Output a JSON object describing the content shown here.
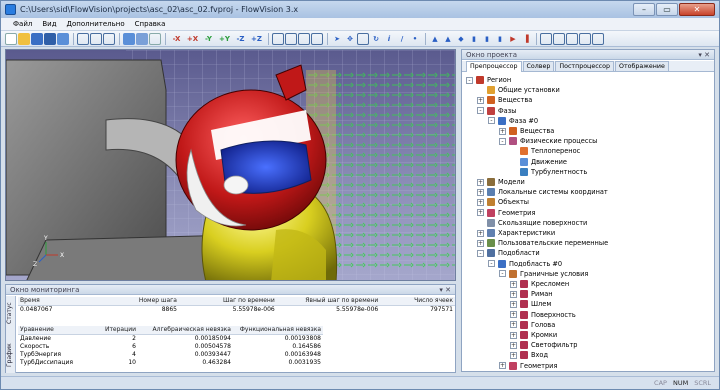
{
  "window": {
    "title": "C:\\Users\\sid\\FlowVision\\projects\\asc_02\\asc_02.fvproj - FlowVision 3.x"
  },
  "menu": [
    "Файл",
    "Вид",
    "Дополнительно",
    "Справка"
  ],
  "toolbar": {
    "axes": [
      "-X",
      "+X",
      "-Y",
      "+Y",
      "-Z",
      "+Z"
    ]
  },
  "viewport": {
    "axis_labels": [
      "Y",
      "X",
      "Z"
    ]
  },
  "monitor": {
    "title": "Окно мониторинга",
    "side_tabs": [
      "Статус",
      "График"
    ],
    "status_headers": [
      "Время",
      "Номер шага",
      "Шаг по времени",
      "Явный шаг по времени",
      "Число ячеек"
    ],
    "status_values": [
      "0.0487067",
      "8865",
      "5.55978e-006",
      "5.55978e-006",
      "797571"
    ],
    "eq_headers": [
      "Уравнение",
      "Итерации",
      "Алгебраическая невязка",
      "Функциональная невязка"
    ],
    "eq_rows": [
      [
        "Давление",
        "2",
        "0.00185094",
        "0.00193808"
      ],
      [
        "Скорость",
        "6",
        "0.00504578",
        "0.164586"
      ],
      [
        "ТурбЭнергия",
        "4",
        "0.00393447",
        "0.00163948"
      ],
      [
        "ТурбДиссипация",
        "10",
        "0.463284",
        "0.0031935"
      ]
    ]
  },
  "project": {
    "title": "Окно проекта",
    "tabs": [
      "Препроцессор",
      "Солвер",
      "Постпроцессор",
      "Отображение"
    ],
    "tree": [
      {
        "label": "Регион",
        "level": 0,
        "exp": "-",
        "icon": "#c0392b"
      },
      {
        "label": "Общие установки",
        "level": 1,
        "exp": "",
        "icon": "#e0a030"
      },
      {
        "label": "Вещества",
        "level": 1,
        "exp": "+",
        "icon": "#d06020"
      },
      {
        "label": "Фазы",
        "level": 1,
        "exp": "-",
        "icon": "#c04040"
      },
      {
        "label": "Фаза #0",
        "level": 2,
        "exp": "-",
        "icon": "#3b6fc4"
      },
      {
        "label": "Вещества",
        "level": 3,
        "exp": "+",
        "icon": "#d06020"
      },
      {
        "label": "Физические процессы",
        "level": 3,
        "exp": "-",
        "icon": "#b05080"
      },
      {
        "label": "Теплоперенос",
        "level": 4,
        "exp": "",
        "icon": "#e07030"
      },
      {
        "label": "Движение",
        "level": 4,
        "exp": "",
        "icon": "#5a8fd8"
      },
      {
        "label": "Турбулентность",
        "level": 4,
        "exp": "",
        "icon": "#3a7fc0"
      },
      {
        "label": "Модели",
        "level": 1,
        "exp": "+",
        "icon": "#8a6d3b"
      },
      {
        "label": "Локальные системы координат",
        "level": 1,
        "exp": "+",
        "icon": "#5b7fb0"
      },
      {
        "label": "Объекты",
        "level": 1,
        "exp": "+",
        "icon": "#c08030"
      },
      {
        "label": "Геометрия",
        "level": 1,
        "exp": "+",
        "icon": "#c04060"
      },
      {
        "label": "Скользящие поверхности",
        "level": 1,
        "exp": "",
        "icon": "#8090a8"
      },
      {
        "label": "Характеристики",
        "level": 1,
        "exp": "+",
        "icon": "#6080b0"
      },
      {
        "label": "Пользовательские переменные",
        "level": 1,
        "exp": "+",
        "icon": "#6a8f4a"
      },
      {
        "label": "Подобласти",
        "level": 1,
        "exp": "-",
        "icon": "#5070a0"
      },
      {
        "label": "Подобласть #0",
        "level": 2,
        "exp": "-",
        "icon": "#3b6fc4"
      },
      {
        "label": "Граничные условия",
        "level": 3,
        "exp": "-",
        "icon": "#c07030"
      },
      {
        "label": "Кресломен",
        "level": 4,
        "exp": "+",
        "icon": "#b03050"
      },
      {
        "label": "Риман",
        "level": 4,
        "exp": "+",
        "icon": "#b03050"
      },
      {
        "label": "Шлем",
        "level": 4,
        "exp": "+",
        "icon": "#b03050"
      },
      {
        "label": "Поверхность",
        "level": 4,
        "exp": "+",
        "icon": "#b03050"
      },
      {
        "label": "Голова",
        "level": 4,
        "exp": "+",
        "icon": "#b03050"
      },
      {
        "label": "Кромки",
        "level": 4,
        "exp": "+",
        "icon": "#b03050"
      },
      {
        "label": "Светофильтр",
        "level": 4,
        "exp": "+",
        "icon": "#b03050"
      },
      {
        "label": "Вход",
        "level": 4,
        "exp": "+",
        "icon": "#b03050"
      },
      {
        "label": "Геометрия",
        "level": 3,
        "exp": "+",
        "icon": "#c04060"
      }
    ]
  },
  "status": {
    "items": [
      "CAP",
      "NUM",
      "SCRL"
    ],
    "active": [
      false,
      true,
      false
    ]
  }
}
